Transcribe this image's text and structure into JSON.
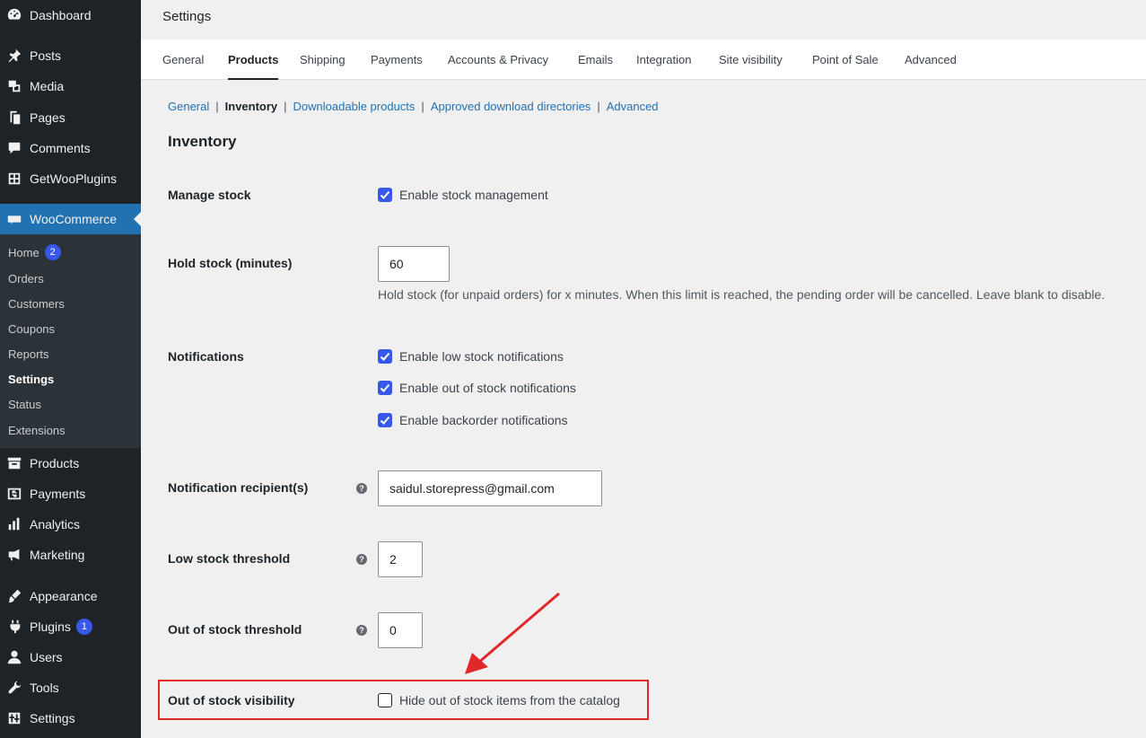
{
  "sidebar": {
    "items": [
      {
        "label": "Dashboard",
        "icon": "dashboard-icon"
      },
      {
        "label": "Posts",
        "icon": "pin-icon"
      },
      {
        "label": "Media",
        "icon": "media-icon"
      },
      {
        "label": "Pages",
        "icon": "pages-icon"
      },
      {
        "label": "Comments",
        "icon": "comment-icon"
      },
      {
        "label": "GetWooPlugins",
        "icon": "plugin-grid-icon"
      },
      {
        "label": "WooCommerce",
        "icon": "woocommerce-icon"
      },
      {
        "label": "Products",
        "icon": "archive-icon"
      },
      {
        "label": "Payments",
        "icon": "dollar-icon"
      },
      {
        "label": "Analytics",
        "icon": "bar-chart-icon"
      },
      {
        "label": "Marketing",
        "icon": "megaphone-icon"
      },
      {
        "label": "Appearance",
        "icon": "brush-icon"
      },
      {
        "label": "Plugins",
        "icon": "plug-icon",
        "badge": "1"
      },
      {
        "label": "Users",
        "icon": "user-icon"
      },
      {
        "label": "Tools",
        "icon": "wrench-icon"
      },
      {
        "label": "Settings",
        "icon": "settings-icon"
      }
    ],
    "woo_submenu": [
      {
        "label": "Home",
        "badge": "2"
      },
      {
        "label": "Orders"
      },
      {
        "label": "Customers"
      },
      {
        "label": "Coupons"
      },
      {
        "label": "Reports"
      },
      {
        "label": "Settings"
      },
      {
        "label": "Status"
      },
      {
        "label": "Extensions"
      }
    ]
  },
  "page": {
    "title": "Settings",
    "tabs": [
      "General",
      "Products",
      "Shipping",
      "Payments",
      "Accounts & Privacy",
      "Emails",
      "Integration",
      "Site visibility",
      "Point of Sale",
      "Advanced"
    ],
    "active_tab": "Products",
    "subsections": [
      "General",
      "Inventory",
      "Downloadable products",
      "Approved download directories",
      "Advanced"
    ],
    "active_subsection": "Inventory",
    "section_title": "Inventory"
  },
  "form": {
    "manage_stock": {
      "label": "Manage stock",
      "checkbox": "Enable stock management",
      "checked": true
    },
    "hold_stock": {
      "label": "Hold stock (minutes)",
      "value": "60",
      "description": "Hold stock (for unpaid orders) for x minutes. When this limit is reached, the pending order will be cancelled. Leave blank to disable."
    },
    "notifications": {
      "label": "Notifications",
      "options": [
        {
          "label": "Enable low stock notifications",
          "checked": true
        },
        {
          "label": "Enable out of stock notifications",
          "checked": true
        },
        {
          "label": "Enable backorder notifications",
          "checked": true
        }
      ]
    },
    "recipient": {
      "label": "Notification recipient(s)",
      "value": "saidul.storepress@gmail.com"
    },
    "low_stock": {
      "label": "Low stock threshold",
      "value": "2"
    },
    "out_of_stock": {
      "label": "Out of stock threshold",
      "value": "0"
    },
    "visibility": {
      "label": "Out of stock visibility",
      "checkbox": "Hide out of stock items from the catalog",
      "checked": false
    }
  },
  "help_glyph": "?",
  "colors": {
    "accent": "#3858e9",
    "sidebar": "#1d2327",
    "woo_active": "#2271b1",
    "annotation": "#e0282a"
  }
}
